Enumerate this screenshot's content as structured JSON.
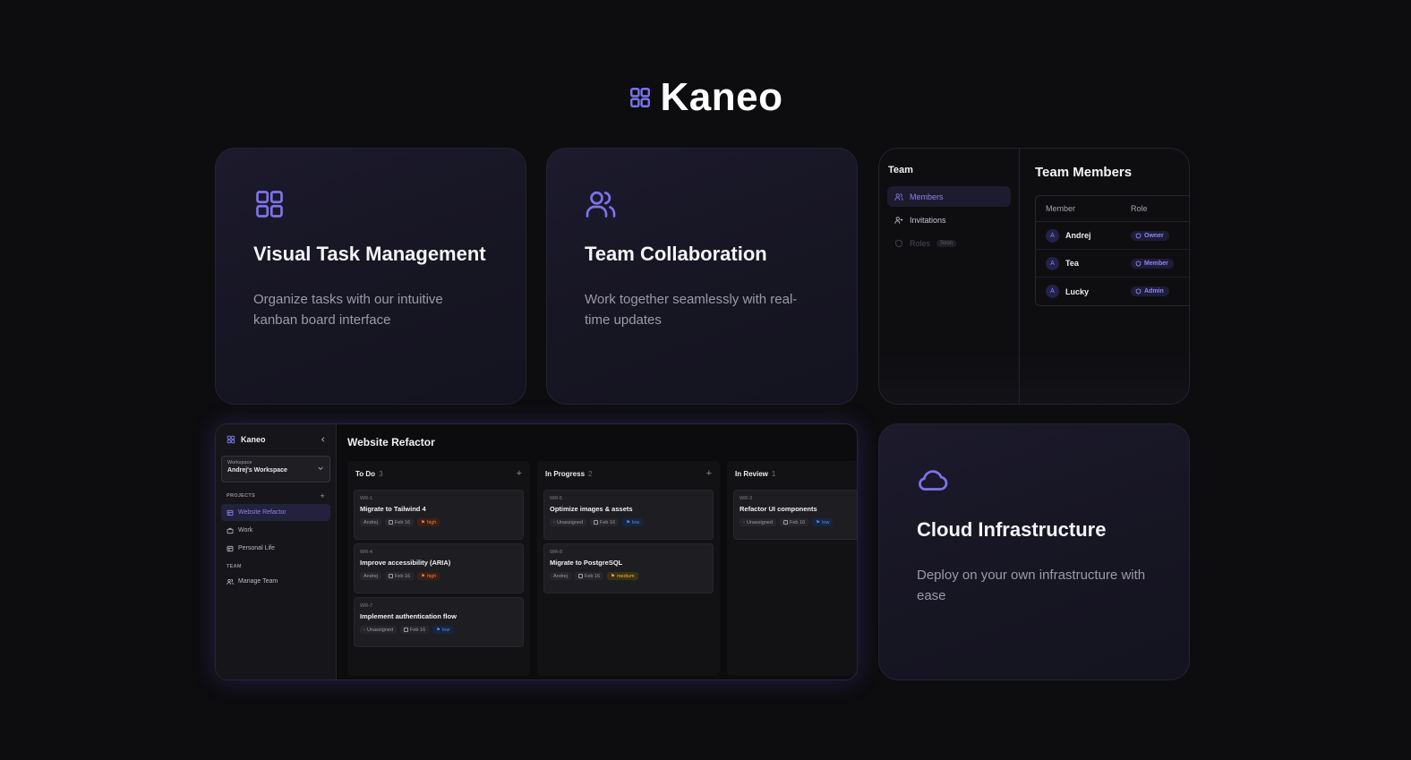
{
  "brand": {
    "name": "Kaneo"
  },
  "features": [
    {
      "title": "Visual Task Management",
      "description": "Organize tasks with our intuitive kanban board interface",
      "icon": "grid-icon"
    },
    {
      "title": "Team Collaboration",
      "description": "Work together seamlessly with real-time updates",
      "icon": "users-icon"
    },
    {
      "title": "Cloud Infrastructure",
      "description": "Deploy on your own infrastructure with ease",
      "icon": "cloud-icon"
    }
  ],
  "team_preview": {
    "sidebar_title": "Team",
    "nav": [
      {
        "label": "Members",
        "active": true
      },
      {
        "label": "Invitations"
      },
      {
        "label": "Roles",
        "badge": "Soon",
        "disabled": true
      }
    ],
    "heading": "Team Members",
    "columns": [
      "Member",
      "Role"
    ],
    "members": [
      {
        "avatar": "A",
        "name": "Andrej",
        "role": "Owner"
      },
      {
        "avatar": "A",
        "name": "Tea",
        "role": "Member"
      },
      {
        "avatar": "A",
        "name": "Lucky",
        "role": "Admin"
      }
    ]
  },
  "board_preview": {
    "brand": "Kaneo",
    "workspace": {
      "label": "Workspace",
      "name": "Andrej's Workspace"
    },
    "projects_label": "PROJECTS",
    "projects": [
      {
        "label": "Website Refactor",
        "active": true
      },
      {
        "label": "Work"
      },
      {
        "label": "Personal Life"
      }
    ],
    "team_label": "TEAM",
    "team_link": "Manage Team",
    "project_title": "Website Refactor",
    "columns": [
      {
        "name": "To Do",
        "count": "3",
        "tasks": [
          {
            "id": "WR-1",
            "title": "Migrate to Tailwind 4",
            "assignee": "Andrej",
            "date": "Feb 16",
            "priority": "high"
          },
          {
            "id": "WR-4",
            "title": "Improve accessibility (ARIA)",
            "assignee": "Andrej",
            "date": "Feb 16",
            "priority": "high"
          },
          {
            "id": "WR-7",
            "title": "Implement authentication flow",
            "assignee": "Unassigned",
            "date": "Feb 16",
            "priority": "low"
          }
        ]
      },
      {
        "name": "In Progress",
        "count": "2",
        "tasks": [
          {
            "id": "WR-5",
            "title": "Optimize images & assets",
            "assignee": "Unassigned",
            "date": "Feb 16",
            "priority": "low"
          },
          {
            "id": "WR-8",
            "title": "Migrate to PostgreSQL",
            "assignee": "Andrej",
            "date": "Feb 16",
            "priority": "medium"
          }
        ]
      },
      {
        "name": "In Review",
        "count": "1",
        "tasks": [
          {
            "id": "WR-3",
            "title": "Refactor UI components",
            "assignee": "Unassigned",
            "date": "Feb 16",
            "priority": "low"
          }
        ]
      }
    ]
  },
  "colors": {
    "accent": "#7c73ec",
    "background": "#0d0d0f",
    "card": "#1a1928",
    "priority_high": "#f07d43",
    "priority_low": "#4f8df5",
    "priority_medium": "#e6b730"
  }
}
